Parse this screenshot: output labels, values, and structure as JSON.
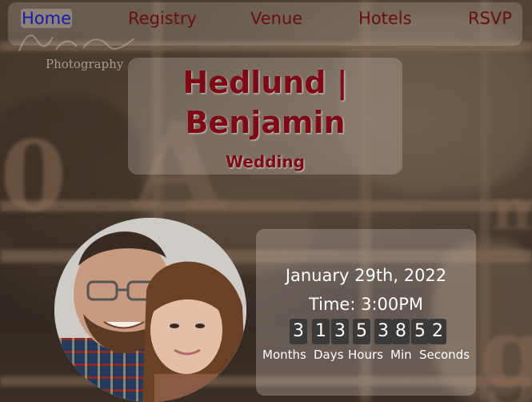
{
  "nav": {
    "items": [
      {
        "label": "Home",
        "active": true
      },
      {
        "label": "Registry"
      },
      {
        "label": "Venue"
      },
      {
        "label": "Hotels"
      },
      {
        "label": "RSVP"
      }
    ]
  },
  "background": {
    "studio_name": "Photography"
  },
  "hero": {
    "title_line1": "Hedlund |",
    "title_line2": "Benjamin",
    "subtitle": "Wedding"
  },
  "event": {
    "date": "January 29th, 2022",
    "time": "Time: 3:00PM"
  },
  "countdown": {
    "digits": {
      "months": [
        "3"
      ],
      "days": [
        "1",
        "3"
      ],
      "hours": [
        "5"
      ],
      "minutes": [
        "3",
        "8"
      ],
      "seconds": [
        "5",
        "2"
      ]
    },
    "labels": {
      "months": "Months",
      "days": "Days",
      "hours": "Hours",
      "minutes": "Min",
      "seconds": "Seconds"
    }
  },
  "colors": {
    "nav_text": "#6a0f0f",
    "nav_active": "#1a1aa6",
    "title": "#7d0a14",
    "digit_bg": "#3b3a38"
  }
}
